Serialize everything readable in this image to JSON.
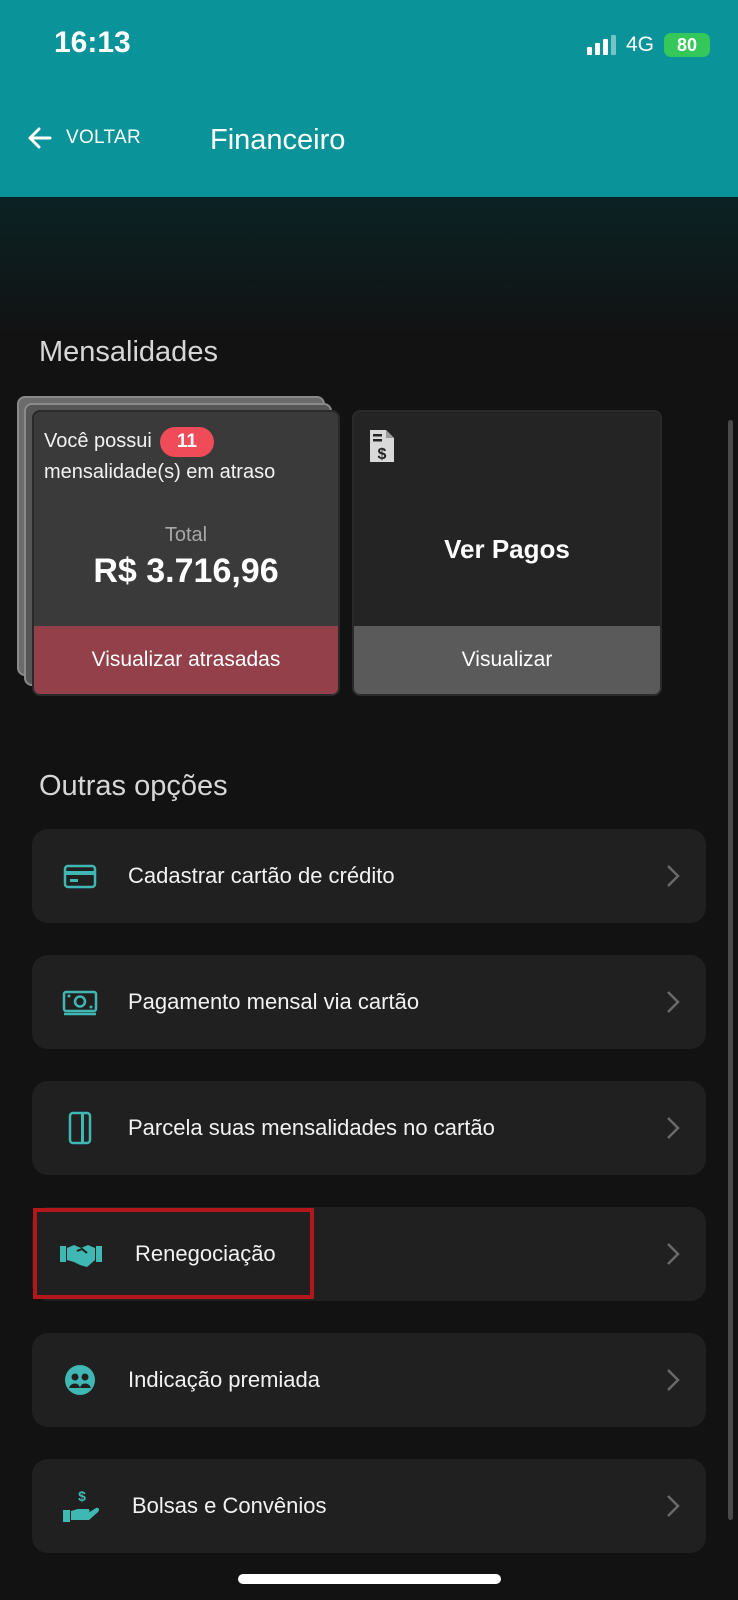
{
  "status_bar": {
    "time": "16:13",
    "network": "4G",
    "battery": "80"
  },
  "header": {
    "back_label": "VOLTAR",
    "title": "Financeiro"
  },
  "mensalidades": {
    "section_title": "Mensalidades",
    "overdue_card": {
      "text_before_badge": "Você possui",
      "badge_count": "11",
      "text_after_badge": "mensalidade(s) em atraso",
      "total_label": "Total",
      "total_value": "R$ 3.716,96",
      "button_label": "Visualizar atrasadas"
    },
    "paid_card": {
      "title": "Ver Pagos",
      "button_label": "Visualizar"
    }
  },
  "other_options": {
    "section_title": "Outras opções",
    "items": [
      {
        "label": "Cadastrar cartão de crédito",
        "icon": "credit-card-icon"
      },
      {
        "label": "Pagamento mensal via cartão",
        "icon": "money-bill-icon"
      },
      {
        "label": "Parcela suas mensalidades no cartão",
        "icon": "card-vertical-icon"
      },
      {
        "label": "Renegociação",
        "icon": "handshake-icon"
      },
      {
        "label": "Indicação premiada",
        "icon": "users-circle-icon"
      },
      {
        "label": "Bolsas e Convênios",
        "icon": "hand-dollar-icon"
      }
    ]
  },
  "colors": {
    "header": "#0a9399",
    "accent_icon": "#3fb8b3",
    "overdue_badge": "#ef4b59",
    "overdue_button": "#93404a",
    "highlight_border": "#b3161b"
  }
}
